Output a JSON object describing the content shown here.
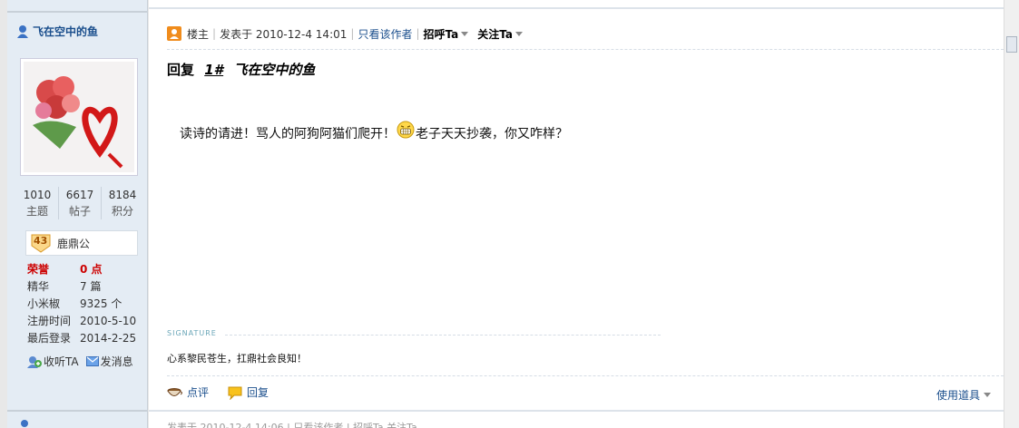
{
  "user": {
    "name": "飞在空中的鱼",
    "stats": [
      {
        "num": "1010",
        "label": "主题"
      },
      {
        "num": "6617",
        "label": "帖子"
      },
      {
        "num": "8184",
        "label": "积分"
      }
    ],
    "rank_level": "43",
    "rank_title": "鹿鼎公",
    "profile": {
      "honor_key": "荣誉",
      "honor_val": "0 点",
      "digest_key": "精华",
      "digest_val": "7 篇",
      "pepper_key": "小米椒",
      "pepper_val": "9325 个",
      "reg_key": "注册时间",
      "reg_val": "2010-5-10",
      "last_key": "最后登录",
      "last_val": "2014-2-25"
    },
    "follow_label": "收听TA",
    "message_label": "发消息"
  },
  "post": {
    "op_label": "楼主",
    "posted_at": "发表于 2010-12-4 14:01",
    "only_author": "只看该作者",
    "greet": "招呼Ta",
    "follow": "关注Ta",
    "reply_prefix": "回复",
    "reply_floor": "1#",
    "reply_to": "飞在空中的鱼",
    "body_before": "读诗的请进！骂人的阿狗阿猫们爬开！",
    "body_after": "老子天天抄袭，你又咋样？",
    "signature_label": "SIGNATURE",
    "signature": "心系黎民苍生，扛鼎社会良知！",
    "comment_label": "点评",
    "reply_label": "回复",
    "tools_label": "使用道具"
  },
  "next_post_snippet": "发表于 2010-12-4 14:06 | 只看该作者 | 招呼Ta  关注Ta",
  "colors": {
    "link": "#1a4e8c",
    "honor": "#cc0000",
    "sidebar_bg": "#e4ecf4"
  }
}
